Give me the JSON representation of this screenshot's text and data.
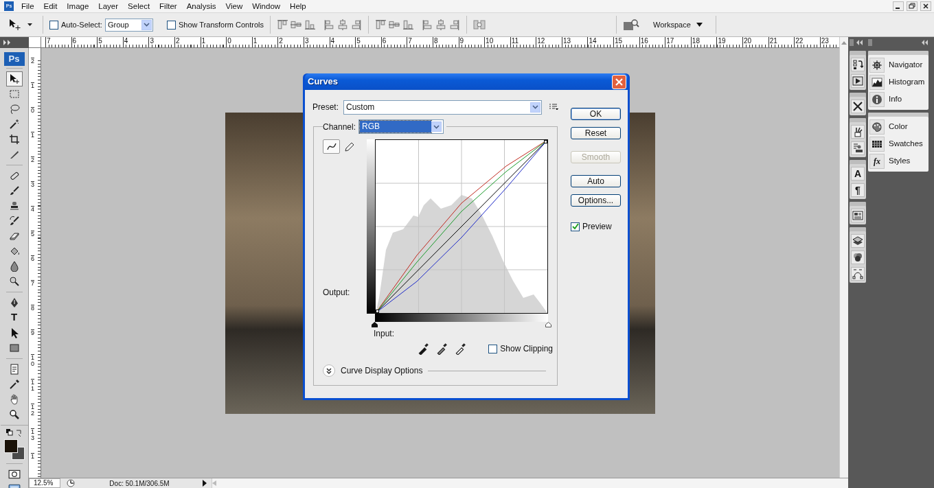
{
  "menubar": {
    "logo": "Ps",
    "items": [
      "File",
      "Edit",
      "Image",
      "Layer",
      "Select",
      "Filter",
      "Analysis",
      "View",
      "Window",
      "Help"
    ]
  },
  "options_bar": {
    "auto_select": {
      "label": "Auto-Select:",
      "checked": false
    },
    "auto_select_target": "Group",
    "show_transform": {
      "label": "Show Transform Controls",
      "checked": false
    },
    "workspace": "Workspace"
  },
  "rulers": {
    "horizontal": [
      "7",
      "6",
      "5",
      "4",
      "3",
      "2",
      "1",
      "0",
      "1",
      "2",
      "3",
      "4",
      "5",
      "6",
      "7",
      "8",
      "9",
      "10",
      "11",
      "12",
      "13",
      "14",
      "15",
      "16",
      "17",
      "18",
      "19",
      "20",
      "21",
      "22",
      "23"
    ],
    "vertical": [
      "2",
      "1",
      "0",
      "1",
      "2",
      "3",
      "4",
      "5",
      "6",
      "7",
      "8",
      "9",
      "10",
      "11",
      "12",
      "13",
      "1"
    ]
  },
  "toolbox": {
    "logo": "Ps",
    "groups": [
      [
        {
          "kind": "move",
          "selected": true
        },
        {
          "kind": "marquee",
          "selected": false
        },
        {
          "kind": "lasso",
          "selected": false
        },
        {
          "kind": "wand",
          "selected": false
        },
        {
          "kind": "crop",
          "selected": false
        },
        {
          "kind": "slice",
          "selected": false
        }
      ],
      [
        {
          "kind": "heal",
          "selected": false
        },
        {
          "kind": "brush",
          "selected": false
        },
        {
          "kind": "stamp",
          "selected": false
        },
        {
          "kind": "historybrush",
          "selected": false
        },
        {
          "kind": "eraser",
          "selected": false
        },
        {
          "kind": "bucket",
          "selected": false
        },
        {
          "kind": "blur",
          "selected": false
        },
        {
          "kind": "dodge",
          "selected": false
        }
      ],
      [
        {
          "kind": "pen",
          "selected": false
        },
        {
          "kind": "type",
          "glyph": "T",
          "selected": false
        },
        {
          "kind": "pathselect",
          "selected": false
        },
        {
          "kind": "shape",
          "selected": false
        }
      ],
      [
        {
          "kind": "notes",
          "selected": false
        },
        {
          "kind": "eyedropper",
          "selected": false
        },
        {
          "kind": "hand",
          "selected": false
        },
        {
          "kind": "zoom",
          "selected": false
        }
      ]
    ],
    "modes": [
      {
        "kind": "quickmask"
      },
      {
        "kind": "screenmode"
      }
    ]
  },
  "dialog": {
    "title": "Curves",
    "preset_label": "Preset:",
    "preset": "Custom",
    "channel_label": "Channel:",
    "channel": "RGB",
    "curve_tools": [
      {
        "kind": "curve",
        "selected": true
      },
      {
        "kind": "pencil",
        "selected": false
      }
    ],
    "output_label": "Output:",
    "input_label": "Input:",
    "show_clipping": {
      "label": "Show Clipping",
      "checked": false
    },
    "display_options": {
      "label": "Curve Display Options",
      "expanded": false
    },
    "buttons": [
      {
        "label": "OK",
        "default": true,
        "disabled": false
      },
      {
        "label": "Reset",
        "default": false,
        "disabled": false
      },
      {
        "label": "Smooth",
        "default": false,
        "disabled": true
      },
      {
        "label": "Auto",
        "default": false,
        "disabled": false
      },
      {
        "label": "Options...",
        "default": false,
        "disabled": false
      }
    ],
    "preview": {
      "label": "Preview",
      "checked": true
    }
  },
  "dock": {
    "icon_groups": [
      [
        {
          "kind": "history"
        },
        {
          "kind": "actions"
        }
      ],
      [
        {
          "kind": "tools"
        }
      ],
      [
        {
          "kind": "brushes"
        },
        {
          "kind": "clone"
        }
      ],
      [
        {
          "kind": "character",
          "glyph": "A"
        },
        {
          "kind": "paragraph",
          "glyph": "¶"
        }
      ],
      [
        {
          "kind": "comps"
        }
      ],
      [
        {
          "kind": "layers"
        },
        {
          "kind": "channels"
        },
        {
          "kind": "paths"
        }
      ]
    ],
    "panel_groups": [
      [
        {
          "kind": "navigator",
          "label": "Navigator"
        },
        {
          "kind": "histogram",
          "label": "Histogram"
        },
        {
          "kind": "info",
          "label": "Info"
        }
      ],
      [
        {
          "kind": "color",
          "label": "Color"
        },
        {
          "kind": "swatches",
          "label": "Swatches"
        },
        {
          "kind": "styles",
          "glyph": "fx",
          "label": "Styles"
        }
      ]
    ]
  },
  "status_bar": {
    "zoom": "12.5%",
    "info": "Doc: 50.1M/306.5M"
  }
}
